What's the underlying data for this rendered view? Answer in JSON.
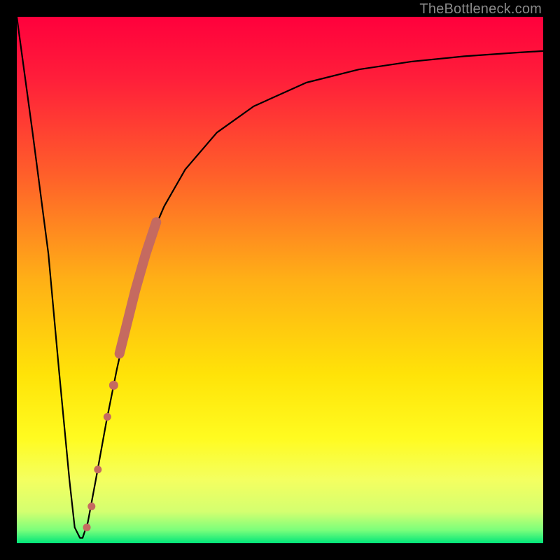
{
  "watermark": "TheBottleneck.com",
  "gradient_stops": [
    {
      "offset": 0.0,
      "color": "#ff003c"
    },
    {
      "offset": 0.12,
      "color": "#ff1f3a"
    },
    {
      "offset": 0.3,
      "color": "#ff5f2a"
    },
    {
      "offset": 0.5,
      "color": "#ffb016"
    },
    {
      "offset": 0.68,
      "color": "#ffe308"
    },
    {
      "offset": 0.8,
      "color": "#fffb20"
    },
    {
      "offset": 0.88,
      "color": "#f4ff60"
    },
    {
      "offset": 0.94,
      "color": "#d4ff70"
    },
    {
      "offset": 0.975,
      "color": "#7bff7b"
    },
    {
      "offset": 1.0,
      "color": "#00e67a"
    }
  ],
  "chart_data": {
    "type": "line",
    "title": "",
    "xlabel": "",
    "ylabel": "",
    "xlim": [
      0,
      100
    ],
    "ylim": [
      0,
      100
    ],
    "series": [
      {
        "name": "bottleneck-curve",
        "x": [
          0,
          3,
          6,
          8,
          10,
          11,
          12,
          12.5,
          13.5,
          15,
          17,
          19,
          21,
          23,
          25,
          28,
          32,
          38,
          45,
          55,
          65,
          75,
          85,
          95,
          100
        ],
        "y": [
          100,
          78,
          55,
          33,
          12,
          3,
          1,
          1,
          4,
          12,
          23,
          33,
          42,
          50,
          57,
          64,
          71,
          78,
          83,
          87.5,
          90,
          91.5,
          92.5,
          93.2,
          93.5
        ]
      }
    ],
    "highlight_band": {
      "name": "thick-segment",
      "color": "#c56a60",
      "x": [
        19.5,
        20.5,
        21.5,
        22.5,
        23.5,
        24.5,
        25.5,
        26.5
      ],
      "y": [
        36,
        40,
        44,
        48,
        51.5,
        55,
        58,
        61
      ]
    },
    "marker_points": {
      "name": "dots",
      "color": "#c56a60",
      "points": [
        {
          "x": 18.4,
          "y": 30
        },
        {
          "x": 17.2,
          "y": 24
        },
        {
          "x": 15.4,
          "y": 14
        },
        {
          "x": 14.2,
          "y": 7
        },
        {
          "x": 13.3,
          "y": 3
        }
      ]
    }
  }
}
